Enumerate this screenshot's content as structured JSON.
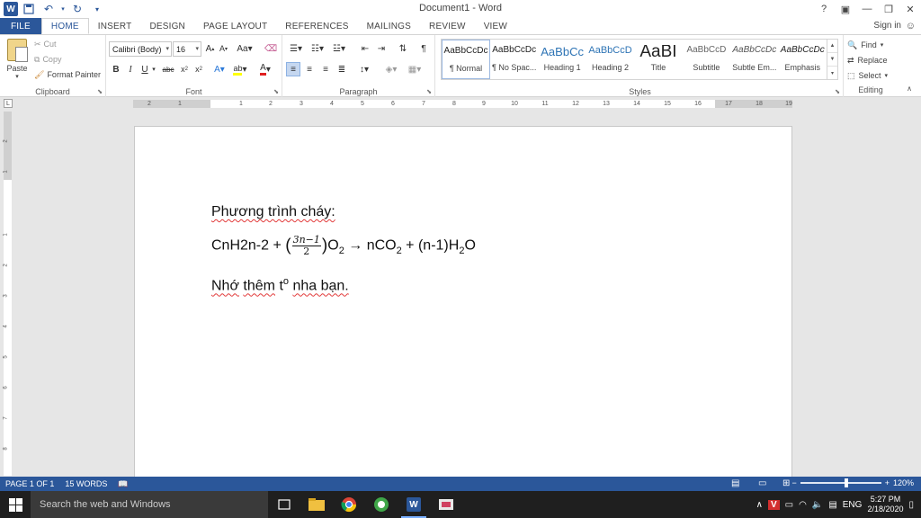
{
  "app": {
    "doc_title": "Document1 - Word",
    "help": "?",
    "sign_in": "Sign in"
  },
  "tabs": [
    "FILE",
    "HOME",
    "INSERT",
    "DESIGN",
    "PAGE LAYOUT",
    "REFERENCES",
    "MAILINGS",
    "REVIEW",
    "VIEW"
  ],
  "ribbon": {
    "clipboard": {
      "label": "Clipboard",
      "paste": "Paste",
      "cut": "Cut",
      "copy": "Copy",
      "format_painter": "Format Painter"
    },
    "font": {
      "label": "Font",
      "font_name": "Calibri (Body)",
      "font_size": "16"
    },
    "paragraph": {
      "label": "Paragraph"
    },
    "styles": {
      "label": "Styles",
      "items": [
        {
          "preview": "AaBbCcDc",
          "name": "¶ Normal"
        },
        {
          "preview": "AaBbCcDc",
          "name": "¶ No Spac..."
        },
        {
          "preview": "AaBbCc",
          "name": "Heading 1"
        },
        {
          "preview": "AaBbCcD",
          "name": "Heading 2"
        },
        {
          "preview": "AaBI",
          "name": "Title"
        },
        {
          "preview": "AaBbCcD",
          "name": "Subtitle"
        },
        {
          "preview": "AaBbCcDc",
          "name": "Subtle Em..."
        },
        {
          "preview": "AaBbCcDc",
          "name": "Emphasis"
        }
      ]
    },
    "editing": {
      "label": "Editing",
      "find": "Find",
      "replace": "Replace",
      "select": "Select"
    }
  },
  "ruler": {
    "tab_marker": "L",
    "h_numbers": [
      "2",
      "1",
      "1",
      "2",
      "3",
      "4",
      "5",
      "6",
      "7",
      "8",
      "9",
      "10",
      "11",
      "12",
      "13",
      "14",
      "15",
      "16",
      "17",
      "18",
      "19"
    ],
    "v_numbers": [
      "2",
      "1",
      "1",
      "2",
      "3",
      "4",
      "5",
      "6",
      "7",
      "8"
    ]
  },
  "document": {
    "line1": "Phương trình cháy:",
    "line2": {
      "part_a": "CnH2n-2 + ",
      "open": "(",
      "frac_num": "3n−1",
      "frac_den": "2",
      "close": ")",
      "o": "O",
      "o_sub": "2",
      "arrow": " → nCO",
      "co_sub": "2",
      "tail": " + (n-1)H",
      "h_sub": "2",
      "end": "O"
    },
    "line3": {
      "word1": "Nhớ",
      "word2": "thêm",
      "t": "t",
      "t_sup": "o",
      "rest": "nha bạn."
    }
  },
  "status": {
    "page": "PAGE 1 OF 1",
    "words": "15 WORDS",
    "zoom": "120%",
    "zoom_level_fraction": 0.55
  },
  "taskbar": {
    "search_placeholder": "Search the web and Windows",
    "lang": "ENG",
    "time": "5:27 PM",
    "date": "2/18/2020"
  },
  "colors": {
    "word_blue": "#2b579a",
    "spell_red": "#e23c3c"
  }
}
